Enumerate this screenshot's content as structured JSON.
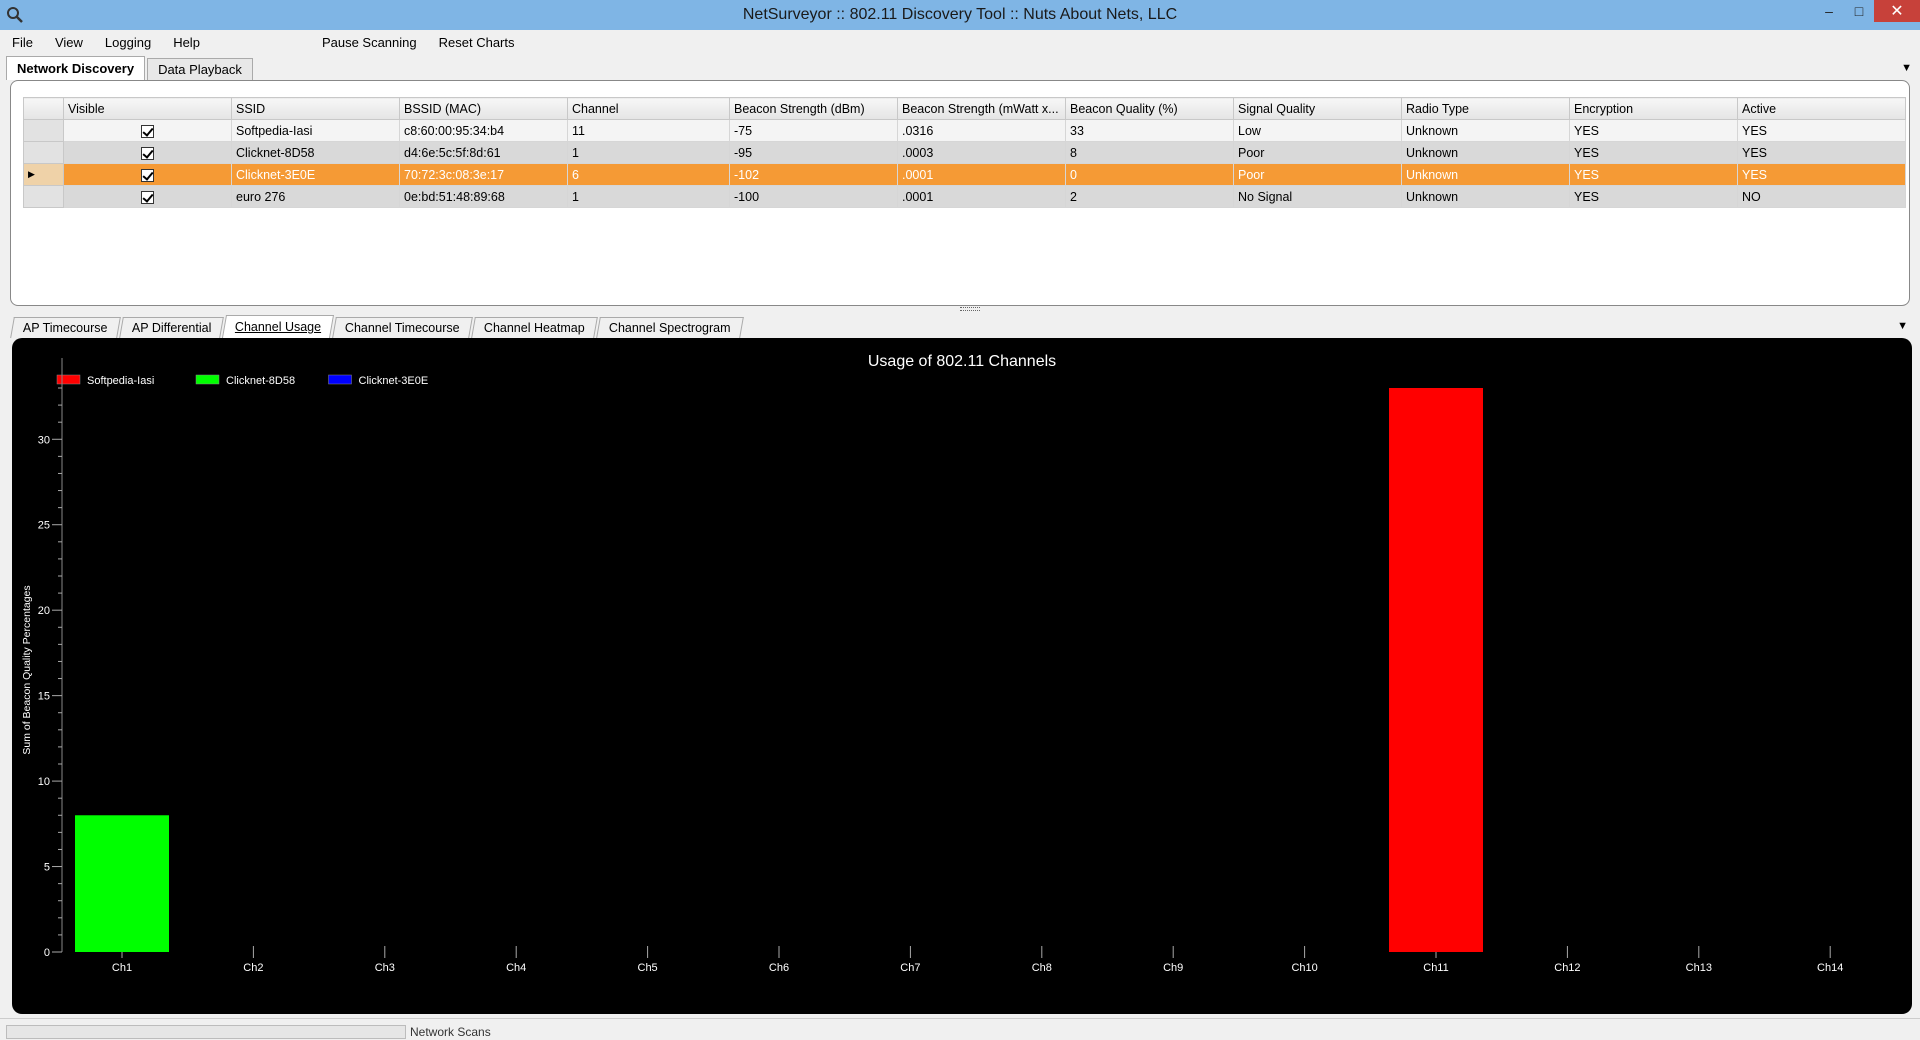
{
  "window": {
    "title": "NetSurveyor :: 802.11 Discovery Tool :: Nuts About Nets, LLC"
  },
  "menu": [
    "File",
    "View",
    "Logging",
    "Help",
    "Pause Scanning",
    "Reset Charts"
  ],
  "top_tabs": [
    {
      "label": "Network Discovery",
      "active": true
    },
    {
      "label": "Data Playback",
      "active": false
    }
  ],
  "grid": {
    "columns": [
      "Visible",
      "SSID",
      "BSSID (MAC)",
      "Channel",
      "Beacon Strength (dBm)",
      "Beacon Strength (mWatt x...",
      "Beacon Quality (%)",
      "Signal Quality",
      "Radio Type",
      "Encryption",
      "Active"
    ],
    "rows": [
      {
        "visible": true,
        "ssid": "Softpedia-Iasi",
        "bssid": "c8:60:00:95:34:b4",
        "channel": "11",
        "dbm": "-75",
        "mwatt": ".0316",
        "quality_pct": "33",
        "signal": "Low",
        "radio": "Unknown",
        "encryption": "YES",
        "active": "YES",
        "selected": false
      },
      {
        "visible": true,
        "ssid": "Clicknet-8D58",
        "bssid": "d4:6e:5c:5f:8d:61",
        "channel": "1",
        "dbm": "-95",
        "mwatt": ".0003",
        "quality_pct": "8",
        "signal": "Poor",
        "radio": "Unknown",
        "encryption": "YES",
        "active": "YES",
        "selected": false
      },
      {
        "visible": true,
        "ssid": "Clicknet-3E0E",
        "bssid": "70:72:3c:08:3e:17",
        "channel": "6",
        "dbm": "-102",
        "mwatt": ".0001",
        "quality_pct": "0",
        "signal": "Poor",
        "radio": "Unknown",
        "encryption": "YES",
        "active": "YES",
        "selected": true
      },
      {
        "visible": true,
        "ssid": "euro 276",
        "bssid": "0e:bd:51:48:89:68",
        "channel": "1",
        "dbm": "-100",
        "mwatt": ".0001",
        "quality_pct": "2",
        "signal": "No Signal",
        "radio": "Unknown",
        "encryption": "YES",
        "active": "NO",
        "selected": false
      }
    ]
  },
  "chart_tabs": [
    {
      "label": "AP Timecourse",
      "active": false
    },
    {
      "label": "AP Differential",
      "active": false
    },
    {
      "label": "Channel Usage",
      "active": true
    },
    {
      "label": "Channel Timecourse",
      "active": false
    },
    {
      "label": "Channel Heatmap",
      "active": false
    },
    {
      "label": "Channel Spectrogram",
      "active": false
    }
  ],
  "chart_data": {
    "type": "bar",
    "title": "Usage of 802.11 Channels",
    "xlabel": "",
    "ylabel": "Sum of Beacon Quality Percentages",
    "categories": [
      "Ch1",
      "Ch2",
      "Ch3",
      "Ch4",
      "Ch5",
      "Ch6",
      "Ch7",
      "Ch8",
      "Ch9",
      "Ch10",
      "Ch11",
      "Ch12",
      "Ch13",
      "Ch14"
    ],
    "ylim": [
      0,
      33
    ],
    "yticks": [
      0,
      5,
      10,
      15,
      20,
      25,
      30
    ],
    "series": [
      {
        "name": "Softpedia-Iasi",
        "color": "#ff0000",
        "values": [
          0,
          0,
          0,
          0,
          0,
          0,
          0,
          0,
          0,
          0,
          33,
          0,
          0,
          0
        ]
      },
      {
        "name": "Clicknet-8D58",
        "color": "#00ff00",
        "values": [
          8,
          0,
          0,
          0,
          0,
          0,
          0,
          0,
          0,
          0,
          0,
          0,
          0,
          0
        ]
      },
      {
        "name": "Clicknet-3E0E",
        "color": "#0000ff",
        "values": [
          0,
          0,
          0,
          0,
          0,
          0,
          0,
          0,
          0,
          0,
          0,
          0,
          0,
          0
        ]
      }
    ],
    "legend_position": "top-left",
    "background": "#000000",
    "grid": false
  },
  "status": {
    "label": "Network Scans"
  },
  "colors": {
    "titlebar": "#7fb5e5",
    "selected_row": "#f59a35",
    "close": "#c7413a"
  }
}
